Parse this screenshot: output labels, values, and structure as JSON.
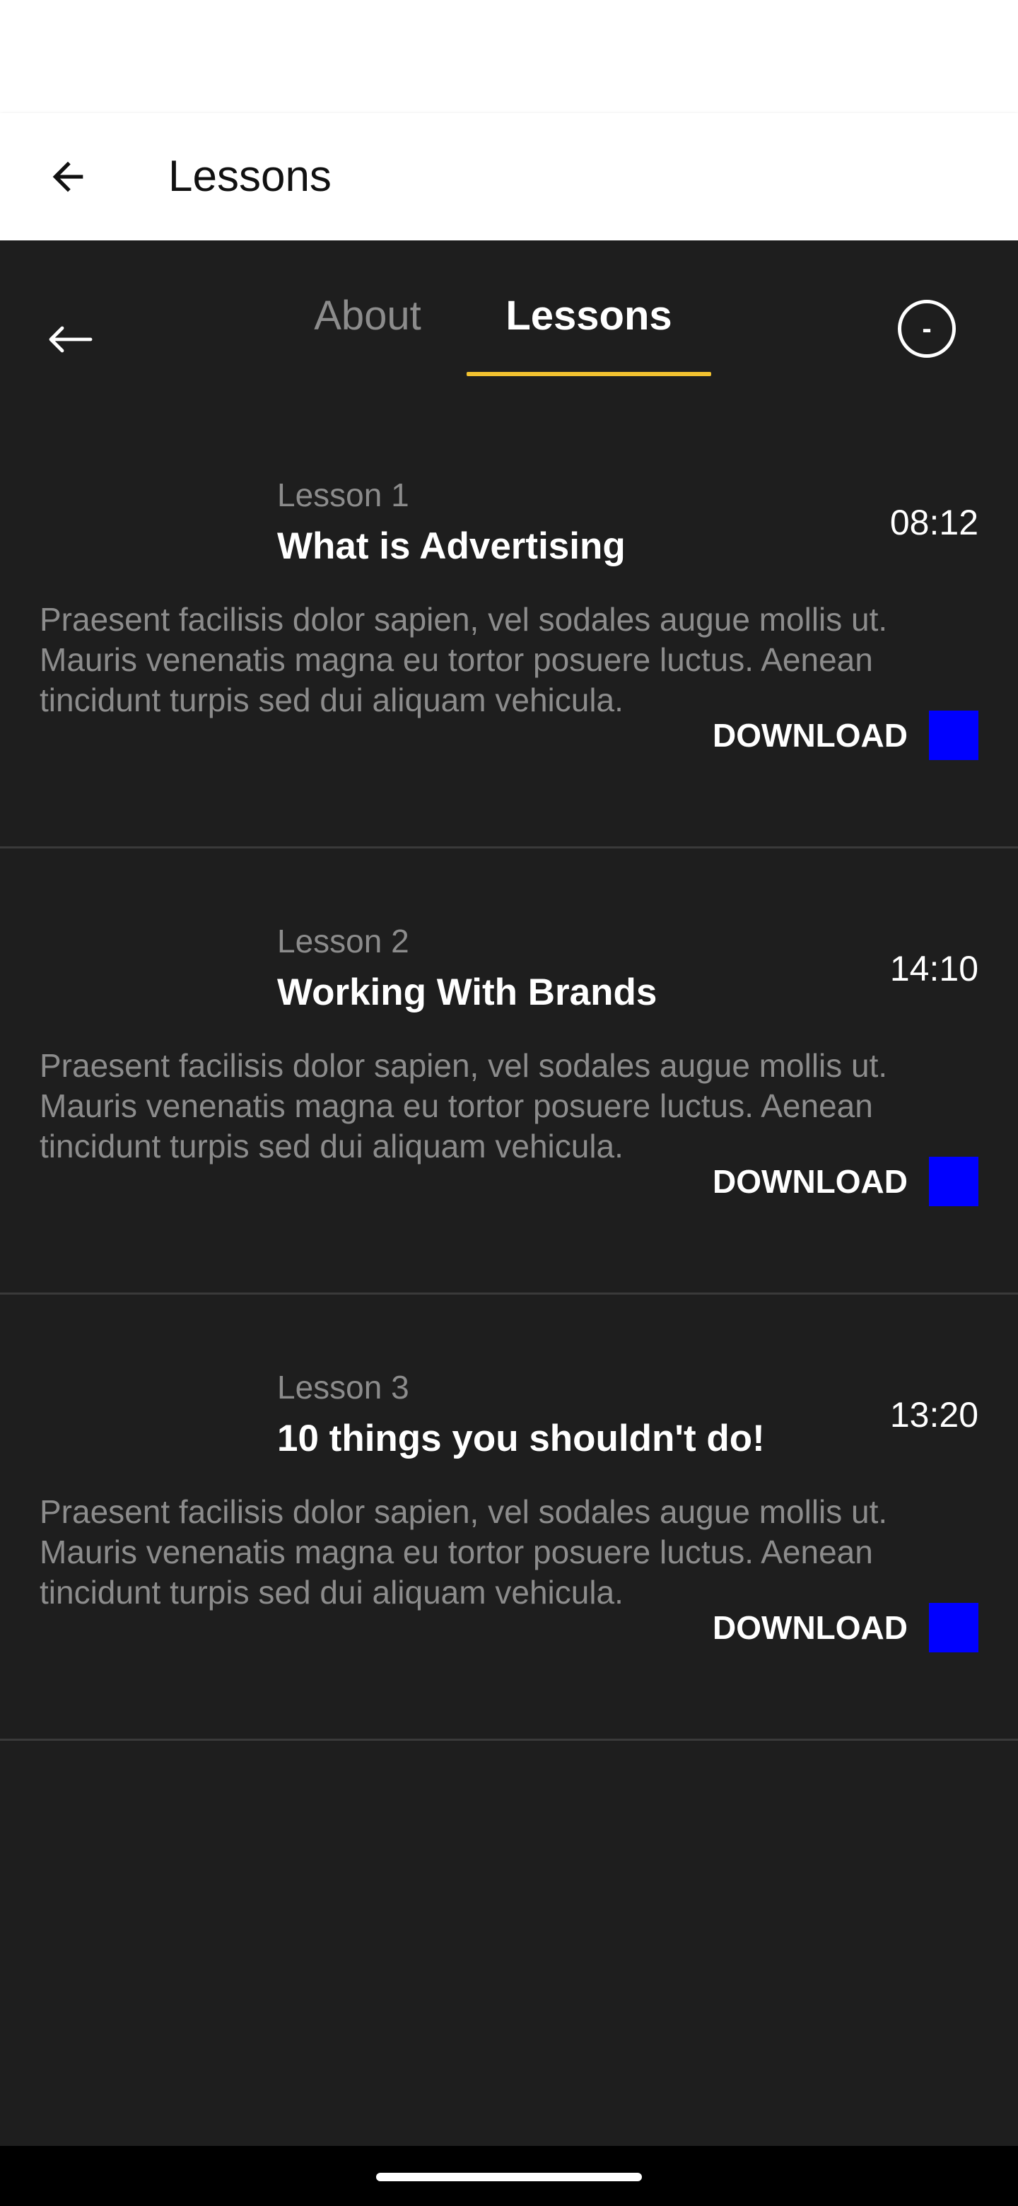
{
  "app_bar": {
    "title": "Lessons",
    "back_icon": "arrow-left-icon"
  },
  "tabs": {
    "back_icon": "arrow-left-icon",
    "about_label": "About",
    "lessons_label": "Lessons",
    "active_tab": "Lessons",
    "underline_color": "#f2c230",
    "circle_button_label": "-"
  },
  "lessons": [
    {
      "number": "Lesson 1",
      "title": "What is Advertising",
      "duration": "08:12",
      "description": "Praesent facilisis dolor sapien, vel sodales augue mollis ut. Mauris venenatis magna eu tortor posuere luctus. Aenean tincidunt turpis sed dui aliquam vehicula.",
      "download_label": "DOWNLOAD"
    },
    {
      "number": "Lesson 2",
      "title": "Working With Brands",
      "duration": "14:10",
      "description": "Praesent facilisis dolor sapien, vel sodales augue mollis ut. Mauris venenatis magna eu tortor posuere luctus. Aenean tincidunt turpis sed dui aliquam vehicula.",
      "download_label": "DOWNLOAD"
    },
    {
      "number": "Lesson 3",
      "title": "10 things you shouldn't do!",
      "duration": "13:20",
      "description": "Praesent facilisis dolor sapien, vel sodales augue mollis ut. Mauris venenatis magna eu tortor posuere luctus. Aenean tincidunt turpis sed dui aliquam vehicula.",
      "download_label": "DOWNLOAD"
    }
  ],
  "colors": {
    "background": "#1e1e1e",
    "accent": "#f2c230",
    "download_swatch": "#0000ff"
  }
}
